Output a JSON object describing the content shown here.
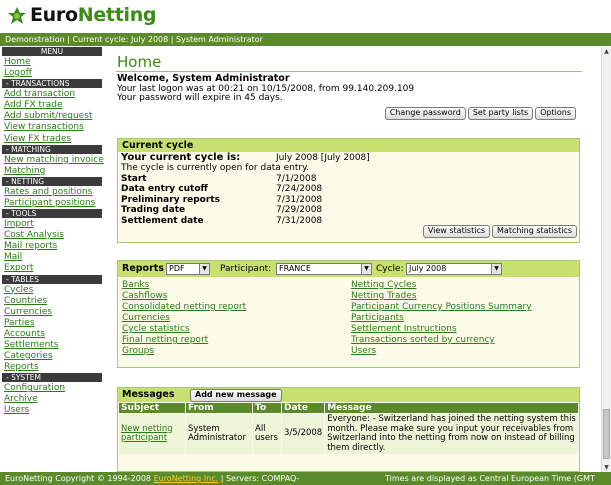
{
  "brand": {
    "part1": "Euro",
    "part2": "Netting"
  },
  "infobar": "Demonstration | Current cycle: July 2008 | System Administrator",
  "sidebar": {
    "sections": [
      {
        "title": "MENU",
        "items": [
          "Home",
          "Logoff"
        ]
      },
      {
        "title": "- TRANSACTIONS",
        "items": [
          "Add transaction",
          "Add FX trade",
          "Add submit/request",
          "View transactions",
          "View FX trades"
        ]
      },
      {
        "title": "- MATCHING",
        "items": [
          "New matching invoice",
          "Matching"
        ]
      },
      {
        "title": "- NETTING",
        "items": [
          "Rates and positions",
          "Participant positions"
        ]
      },
      {
        "title": "- TOOLS",
        "items": [
          "Import",
          "Cost Analysis",
          "Mail reports",
          "Mail",
          "Export"
        ]
      },
      {
        "title": "- TABLES",
        "items": [
          "Cycles",
          "Countries",
          "Currencies",
          "Parties",
          "Accounts",
          "Settlements",
          "Categories",
          "Reports"
        ]
      },
      {
        "title": "- SYSTEM",
        "items": [
          "Configuration",
          "Archive",
          "Users"
        ]
      }
    ]
  },
  "main": {
    "title": "Home",
    "welcome": {
      "heading": "Welcome, System Administrator",
      "line1": "Your last logon was at 00:21 on 10/15/2008, from 99.140.209.109",
      "line2": "Your password will expire in 45 days."
    },
    "account_buttons": [
      "Change password",
      "Set party lists",
      "Options"
    ],
    "cycle": {
      "title": "Current cycle",
      "current_label": "Your current cycle is:",
      "current_value": "July 2008 [July 2008]",
      "status_text": "The cycle is currently open for data entry.",
      "rows": [
        {
          "label": "Start",
          "value": "7/1/2008"
        },
        {
          "label": "Data entry cutoff",
          "value": "7/24/2008"
        },
        {
          "label": "Preliminary reports",
          "value": "7/31/2008"
        },
        {
          "label": "Trading date",
          "value": "7/29/2008"
        },
        {
          "label": "Settlement date",
          "value": "7/31/2008"
        }
      ],
      "buttons": [
        "View statistics",
        "Matching statistics"
      ]
    },
    "reports": {
      "title": "Reports",
      "format_value": "PDF",
      "participant_label": "Participant:",
      "participant_value": "FRANCE",
      "cycle_label": "Cycle:",
      "cycle_value": "July 2008",
      "left": [
        "Banks",
        "Cashflows",
        "Consolidated netting report",
        "Currencies",
        "Cycle statistics",
        "Final netting report",
        "Groups"
      ],
      "right": [
        "Netting Cycles",
        "Netting Trades",
        "Participant Currency Positions Summary",
        "Participants",
        "Settlement Instructions",
        "Transactions sorted by currency",
        "Users"
      ]
    },
    "messages": {
      "title": "Messages",
      "add_button": "Add new message",
      "columns": [
        "Subject",
        "From",
        "To",
        "Date",
        "Message"
      ],
      "rows": [
        {
          "subject": "New netting participant",
          "from": "System Administrator",
          "to": "All users",
          "date": "3/5/2008",
          "message": "Everyone: - Switzerland has joined the netting system this month. Please make sure you input your receivables from Switzerland into the netting from now on instead of billing them directly."
        }
      ]
    }
  },
  "footer": {
    "left_prefix": "EuroNetting Copyright © 1994-2008 ",
    "left_link": "EuroNetting Inc.",
    "left_suffix": " | Servers: COMPAQ-",
    "right": "Times are displayed as Central European Time (GMT"
  },
  "colors": {
    "accent_green": "#3a8c17",
    "bar_green": "#5a8a2c",
    "panel_head": "#c8e070"
  }
}
